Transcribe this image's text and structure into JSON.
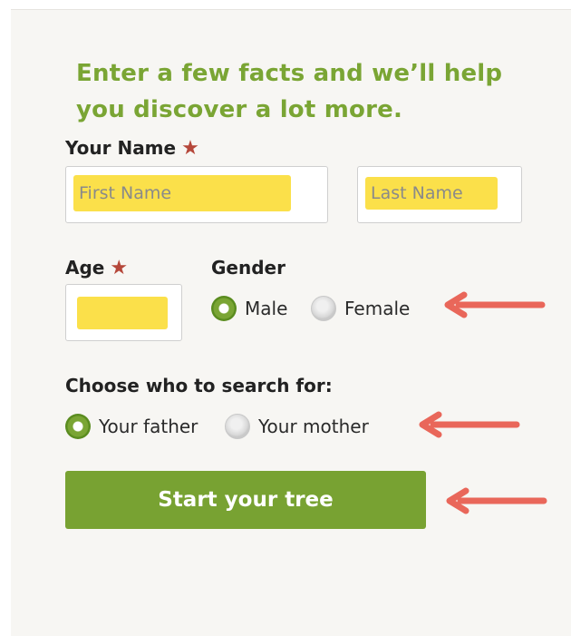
{
  "headline": "Enter a few facts and we’ll help you discover a lot more.",
  "name_section": {
    "label": "Your Name",
    "required_mark": "★",
    "first_name_placeholder": "First Name",
    "last_name_placeholder": "Last Name"
  },
  "age_section": {
    "label": "Age",
    "required_mark": "★",
    "value": ""
  },
  "gender_section": {
    "label": "Gender",
    "options": [
      {
        "label": "Male",
        "selected": true
      },
      {
        "label": "Female",
        "selected": false
      }
    ]
  },
  "search_section": {
    "label": "Choose who to search for:",
    "options": [
      {
        "label": "Your father",
        "selected": true
      },
      {
        "label": "Your mother",
        "selected": false
      }
    ]
  },
  "cta": {
    "label": "Start your tree"
  },
  "colors": {
    "accent_green": "#7aa534",
    "highlight_yellow": "#fbe04a",
    "required_red": "#b5473a",
    "arrow_red": "#e9675a"
  },
  "icons": {
    "required": "asterisk-star-icon",
    "arrow": "arrow-left-icon"
  }
}
